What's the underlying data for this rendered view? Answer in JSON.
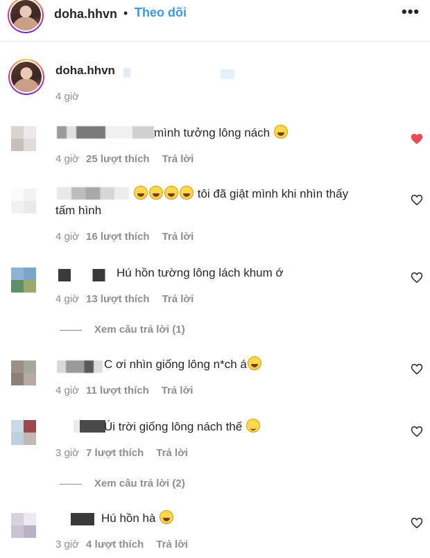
{
  "header": {
    "username": "doha.hhvn",
    "dot": "•",
    "follow_label": "Theo dõi",
    "more_icon": "•••"
  },
  "caption": {
    "username": "doha.hhvn",
    "time": "4 giờ"
  },
  "comments": [
    {
      "text": "mình tưởng lông nách",
      "emojis": [
        "laugh-icon"
      ],
      "time": "4 giờ",
      "likes": "25 lượt thích",
      "reply": "Trả lời",
      "liked": true
    },
    {
      "text": "tôi đã giật mình khi nhìn thấy",
      "text2": "tấm hình",
      "emojis": [
        "laugh-icon",
        "laugh-icon",
        "laugh-icon",
        "laugh-icon"
      ],
      "time": "4 giờ",
      "likes": "16 lượt thích",
      "reply": "Trả lời",
      "liked": false
    },
    {
      "text": "Hú hồn tường lông lách khum ớ",
      "time": "4 giờ",
      "likes": "13 lượt thích",
      "reply": "Trả lời",
      "liked": false,
      "view_replies": "Xem câu trả lời (1)"
    },
    {
      "text": "C ơi nhìn giống lông n*ch á",
      "emojis": [
        "sweat-smile-icon"
      ],
      "time": "4 giờ",
      "likes": "11 lượt thích",
      "reply": "Trả lời",
      "liked": false
    },
    {
      "text": "Úi trời giống lông nách thế",
      "emojis": [
        "smile-icon"
      ],
      "time": "3 giờ",
      "likes": "7 lượt thích",
      "reply": "Trả lời",
      "liked": false,
      "view_replies": "Xem câu trả lời (2)"
    },
    {
      "text": "Hú hồn hà",
      "emojis": [
        "laugh-icon"
      ],
      "time": "3 giờ",
      "likes": "4 lượt thích",
      "reply": "Trả lời",
      "liked": false
    }
  ],
  "colors": {
    "accent": "#3897f0",
    "like_red": "#ed4956",
    "muted": "#8e8e8e"
  }
}
